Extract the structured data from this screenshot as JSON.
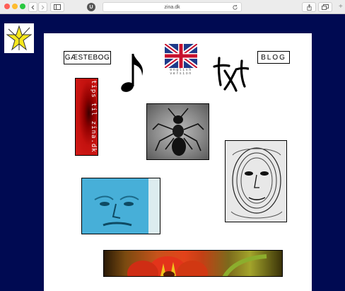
{
  "browser": {
    "url": "zina.dk",
    "badge": "U"
  },
  "links": {
    "guestbook": "GÆSTEBOG",
    "blog": "BLOG",
    "english": "english\nversion"
  },
  "tips_text": "tips til zina.dk",
  "colors": {
    "background": "#000a52",
    "paper": "#ffffff"
  }
}
